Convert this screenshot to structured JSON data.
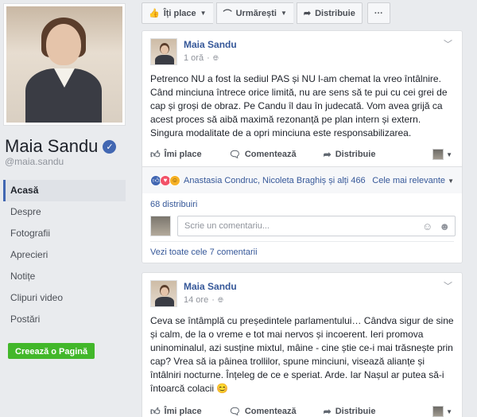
{
  "profile": {
    "name": "Maia Sandu",
    "handle": "@maia.sandu"
  },
  "nav": {
    "items": [
      "Acasă",
      "Despre",
      "Fotografii",
      "Aprecieri",
      "Notițe",
      "Clipuri video",
      "Postări"
    ],
    "active_index": 0,
    "create_page": "Creează o Pagină"
  },
  "actionbar": {
    "like": "Îți place",
    "follow": "Urmărești",
    "share": "Distribuie",
    "more": "···"
  },
  "colors": {
    "link": "#365899",
    "accent": "#4267b2",
    "create_button": "#42b72a",
    "background": "#e9ebee"
  },
  "posts": [
    {
      "author": "Maia Sandu",
      "time": "1 oră",
      "text": "Petrenco NU a fost la sediul PAS și NU l-am chemat la vreo întâlnire. Când minciuna întrece orice limită, nu are sens să te pui cu cei grei de cap și groși de obraz. Pe Candu îl dau în judecată. Vom avea grijă ca acest proces să aibă maximă rezonanță pe plan intern și extern. Singura modalitate de a opri minciuna este responsabilizarea.",
      "actions": {
        "like": "Îmi place",
        "comment": "Comentează",
        "share": "Distribuie"
      },
      "reactions_text": "Anastasia Condruc, Nicoleta Braghiș și alți 466",
      "sort_label": "Cele mai relevante",
      "shares": "68 distribuiri",
      "comment_placeholder": "Scrie un comentariu...",
      "view_comments": "Vezi toate cele 7 comentarii"
    },
    {
      "author": "Maia Sandu",
      "time": "14 ore",
      "text": "Ceva se întâmplă cu președintele parlamentului… Cândva sigur de sine și calm, de la o vreme e tot mai nervos și incoerent. Ieri promova uninominalul, azi susține mixtul, mâine - cine știe ce-i mai trăsnește prin cap? Vrea să ia pâinea trollilor, spune minciuni, visează alianțe și întâlniri nocturne. Înțeleg de ce e speriat. Arde. Iar Nașul ar putea să-i întoarcă colacii 😊",
      "actions": {
        "like": "Îmi place",
        "comment": "Comentează",
        "share": "Distribuie"
      }
    }
  ],
  "icons": {
    "verified": "verified-badge-icon",
    "like": "thumbs-up-icon",
    "comment": "comment-bubble-icon",
    "share": "share-arrow-icon",
    "globe": "globe-icon",
    "emoji": "emoji-icon",
    "sticker": "sticker-icon"
  }
}
